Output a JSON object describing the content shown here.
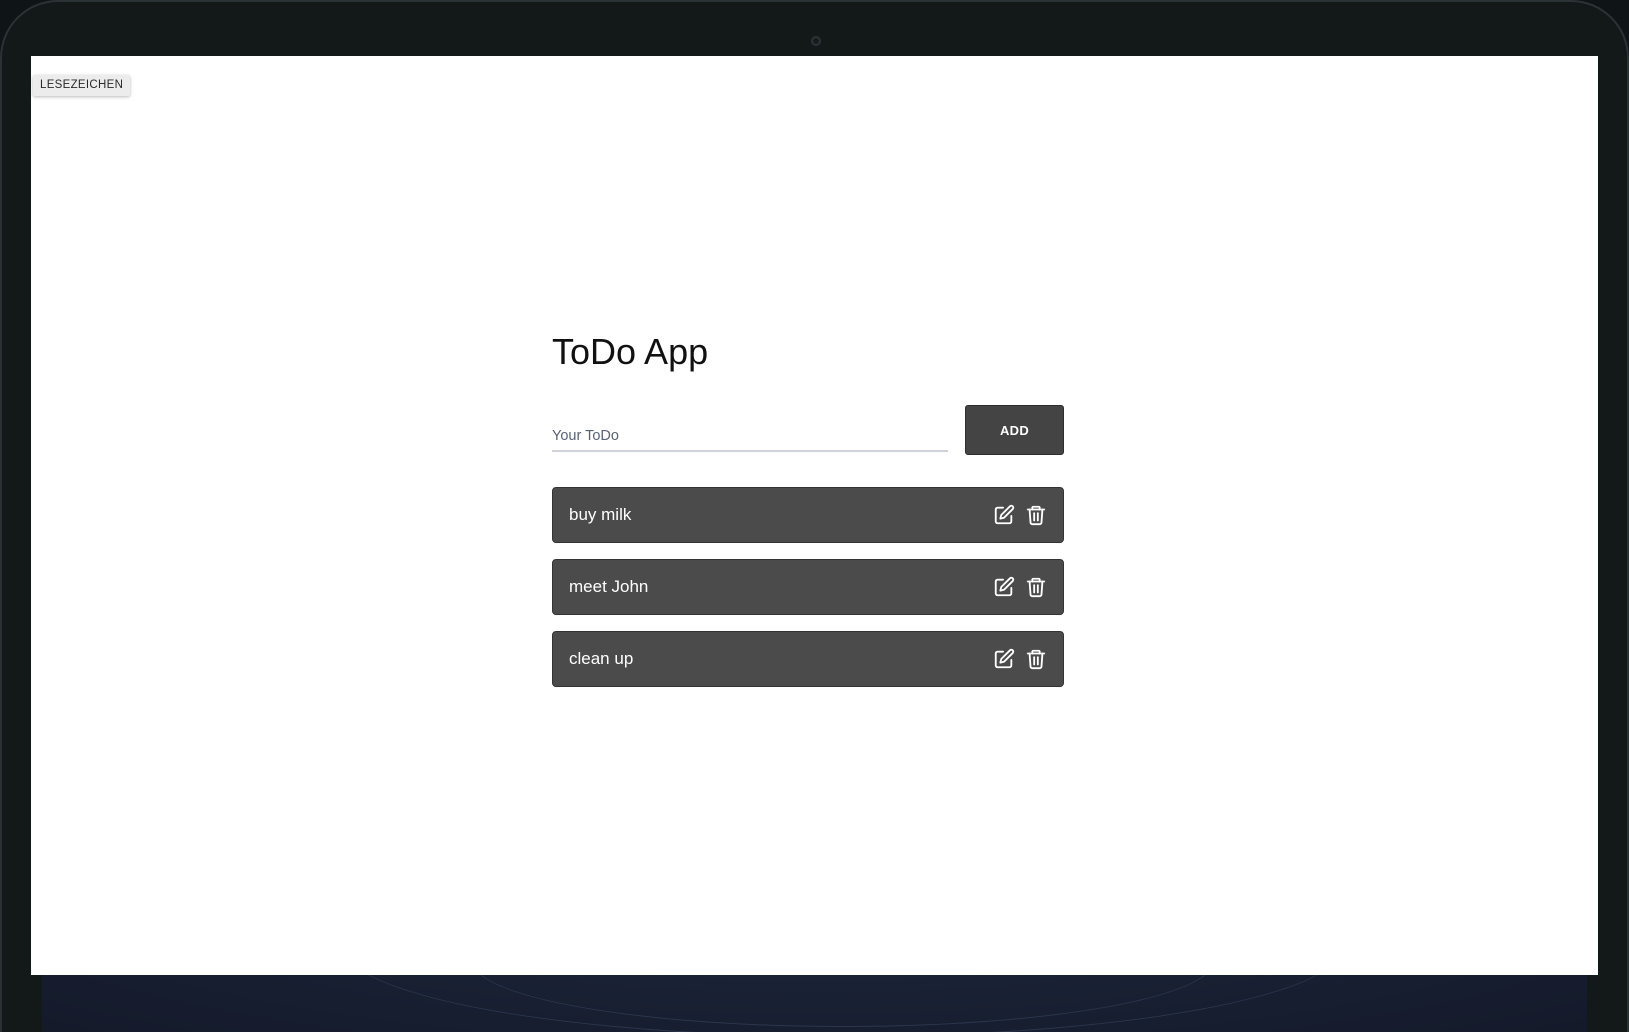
{
  "bookmarks_bar": {
    "label": "LESEZEICHEN"
  },
  "app": {
    "title": "ToDo App",
    "input": {
      "placeholder": "Your ToDo",
      "value": ""
    },
    "add_button_label": "ADD",
    "todos": [
      {
        "text": "buy milk",
        "edit_icon": "edit-icon",
        "delete_icon": "trash-icon"
      },
      {
        "text": "meet John",
        "edit_icon": "edit-icon",
        "delete_icon": "trash-icon"
      },
      {
        "text": "clean up",
        "edit_icon": "edit-icon",
        "delete_icon": "trash-icon"
      }
    ]
  },
  "colors": {
    "item_background": "#4b4b4b",
    "button_background": "#444444",
    "text_on_dark": "#ffffff",
    "page_background": "#ffffff",
    "device_frame": "#131819"
  }
}
